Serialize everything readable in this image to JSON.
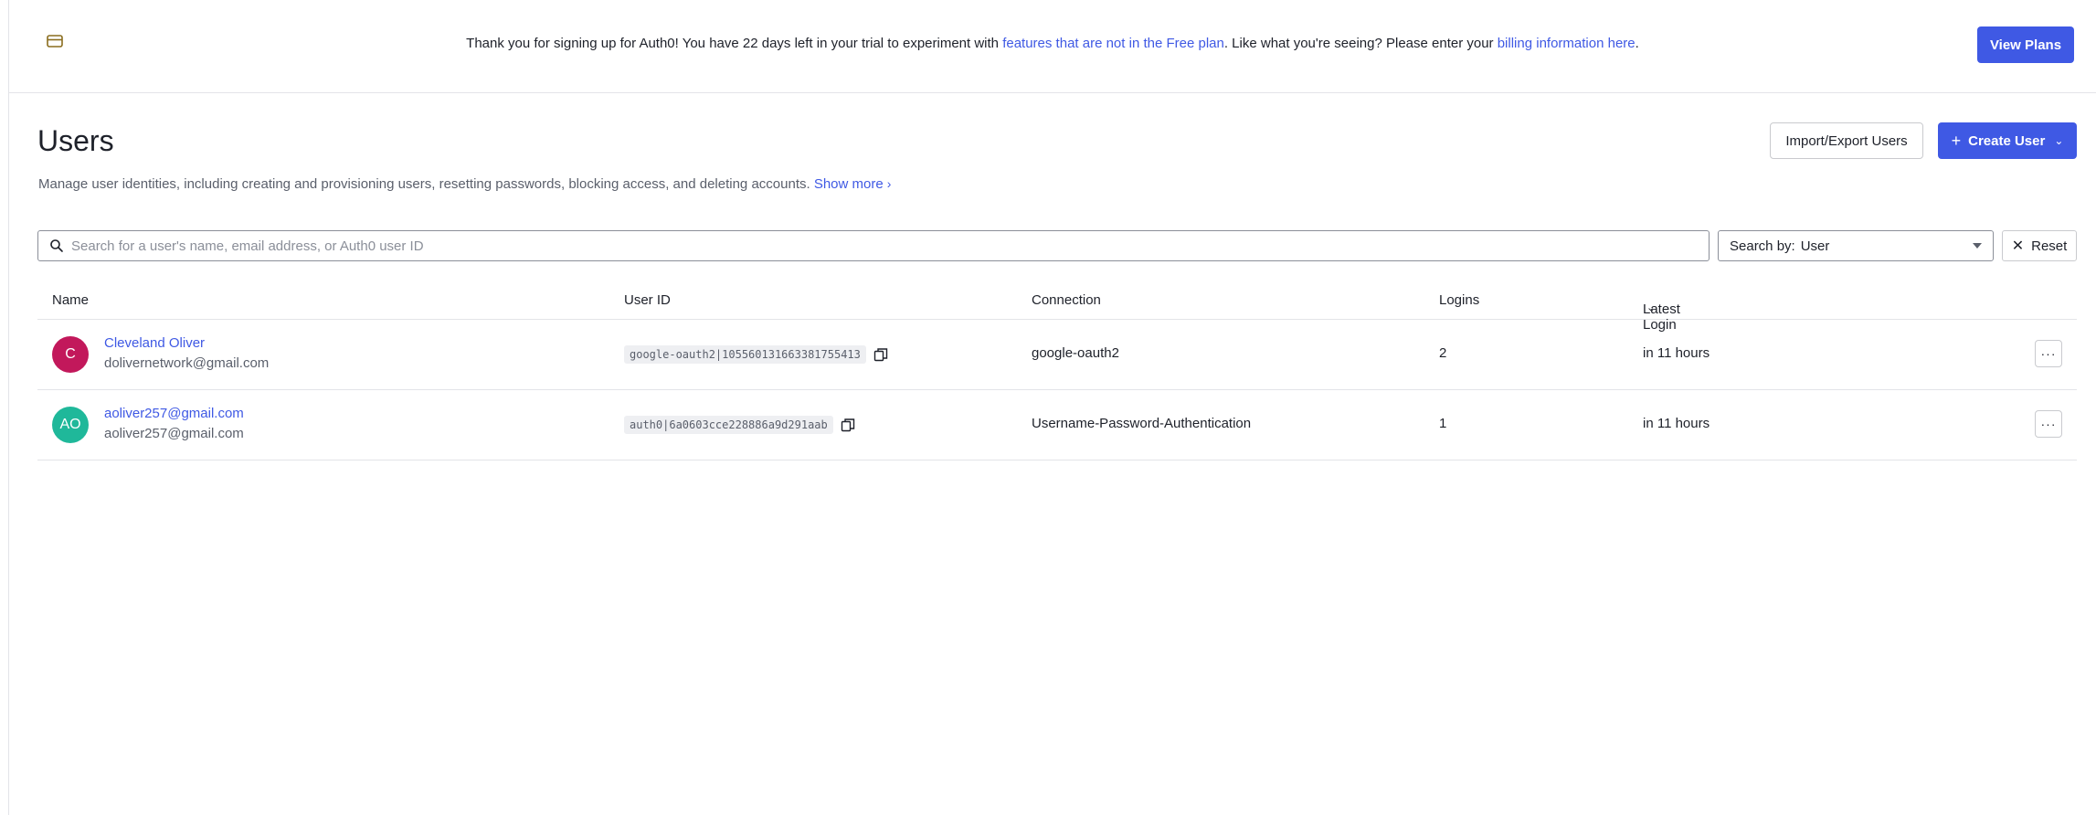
{
  "banner": {
    "text_before": "Thank you for signing up for Auth0! You have 22 days left in your trial to experiment with ",
    "link1": "features that are not in the Free plan",
    "text_middle": ". Like what you're seeing? Please enter your ",
    "link2": "billing information here",
    "text_after": ".",
    "view_plans_label": "View Plans",
    "icon": "credit-card-icon"
  },
  "header": {
    "title": "Users",
    "description": "Manage user identities, including creating and provisioning users, resetting passwords, blocking access, and deleting accounts. ",
    "show_more": "Show more",
    "import_export_label": "Import/Export Users",
    "create_user_label": "Create User"
  },
  "search": {
    "placeholder": "Search for a user's name, email address, or Auth0 user ID",
    "search_by_prefix": "Search by:",
    "search_by_value": "User",
    "reset_label": "Reset"
  },
  "table": {
    "columns": {
      "name": "Name",
      "user_id": "User ID",
      "connection": "Connection",
      "logins": "Logins",
      "latest_login": "Latest Login"
    },
    "rows": [
      {
        "initials": "C",
        "avatar_color": "#c2185b",
        "name": "Cleveland Oliver",
        "email": "dolivernetwork@gmail.com",
        "user_id": "google-oauth2|105560131663381755413",
        "connection": "google-oauth2",
        "logins": "2",
        "latest_login": "in 11 hours"
      },
      {
        "initials": "AO",
        "avatar_color": "#1fb89a",
        "name": "aoliver257@gmail.com",
        "email": "aoliver257@gmail.com",
        "user_id": "auth0|6a0603cce228886a9d291aab",
        "connection": "Username-Password-Authentication",
        "logins": "1",
        "latest_login": "in 11 hours"
      }
    ]
  },
  "colors": {
    "accent": "#3f59e4",
    "border": "#e3e4e8",
    "text": "#1e212a",
    "muted": "#5a5f6b"
  }
}
